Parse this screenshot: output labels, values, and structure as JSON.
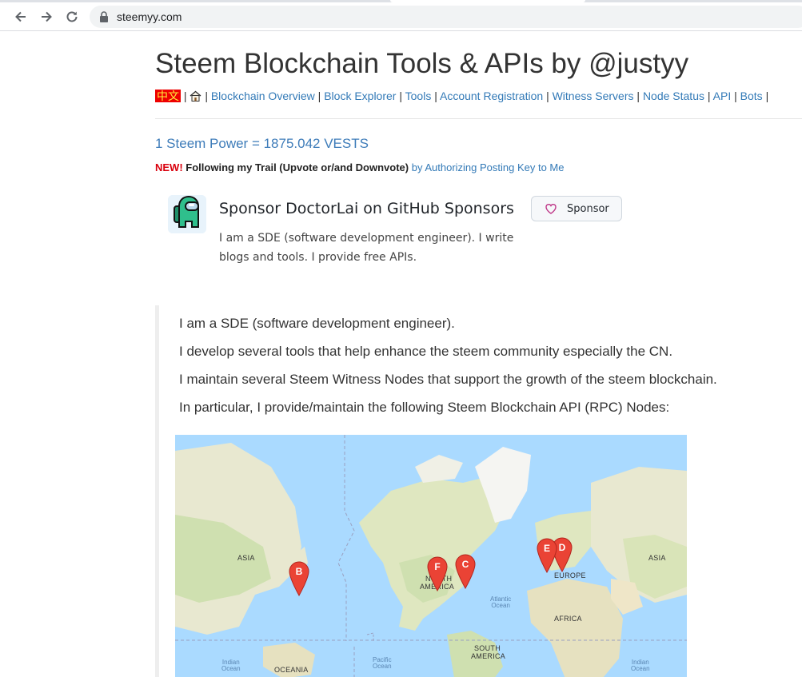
{
  "browser": {
    "url": "steemyy.com",
    "icons": {
      "back": "arrow-left-icon",
      "forward": "arrow-right-icon",
      "reload": "reload-icon",
      "lock": "lock-icon"
    }
  },
  "page": {
    "title": "Steem Blockchain Tools & APIs by @justyy",
    "nav": {
      "lang": "中文",
      "sep": "|",
      "home_icon": "house-icon",
      "links": [
        "Blockchain Overview",
        "Block Explorer",
        "Tools",
        "Account Registration",
        "Witness Servers",
        "Node Status",
        "API",
        "Bots"
      ]
    },
    "steem_power": "1 Steem Power = 1875.042 VESTS",
    "trail": {
      "new": "NEW!",
      "bold": "Following my Trail (Upvote or/and Downvote)",
      "link": "by Authorizing Posting Key to Me"
    },
    "sponsor": {
      "title": "Sponsor DoctorLai on GitHub Sponsors",
      "description": "I am a SDE (software development engineer). I write blogs and tools. I provide free APIs.",
      "button": "Sponsor",
      "button_icon": "heart-icon",
      "avatar_icon": "among-us-crewmate-icon"
    },
    "quote": {
      "lines": [
        "I am a SDE (software development engineer).",
        "I develop several tools that help enhance the steem community especially the CN.",
        "I maintain several Steem Witness Nodes that support the growth of the steem blockchain.",
        "In particular, I provide/maintain the following Steem Blockchain API (RPC) Nodes:"
      ]
    },
    "map": {
      "labels": {
        "asia_left": "ASIA",
        "asia_right": "ASIA",
        "north": "NORTH",
        "america": "AMERICA",
        "europe": "EUROPE",
        "africa": "AFRICA",
        "south": "SOUTH",
        "south_america": "AMERICA",
        "oceania": "OCEANIA"
      },
      "oceans": {
        "atlantic_1": "Atlantic",
        "atlantic_2": "Ocean",
        "pacific_1": "Pacific",
        "pacific_2": "Ocean",
        "indian_left_1": "Indian",
        "indian_left_2": "Ocean",
        "indian_right_1": "Indian",
        "indian_right_2": "Ocean"
      },
      "markers": [
        "B",
        "F",
        "C",
        "E",
        "D"
      ],
      "marker_color": "#ea4335"
    }
  }
}
